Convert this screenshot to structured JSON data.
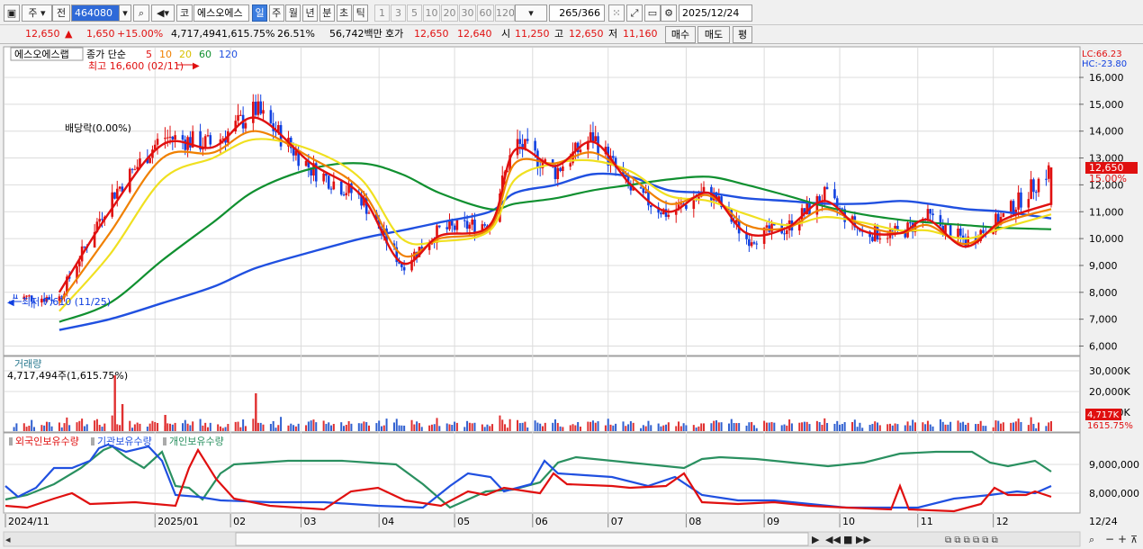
{
  "toolbar": {
    "period_label": "주",
    "prev_label": "전",
    "stock_code": "464080",
    "stock_name_short": "코",
    "stock_name": "에스오에스",
    "intervals": [
      "일",
      "주",
      "월",
      "년",
      "분",
      "초",
      "틱"
    ],
    "active_interval": "일",
    "counts": [
      "1",
      "3",
      "5",
      "10",
      "20",
      "30",
      "60",
      "120"
    ],
    "bar_count": "265",
    "bar_total": "/366",
    "date": "2025/12/24"
  },
  "info": {
    "price": "12,650",
    "change": "1,650",
    "change_pct": "+15.00%",
    "volume": "4,717,494",
    "volume_pct": "1,615.75%",
    "turnover_rate": "26.51%",
    "amount": "56,742백만",
    "quote_label": "호가",
    "ask": "12,650",
    "bid": "12,640",
    "open_label": "시",
    "open": "11,250",
    "high_label": "고",
    "high": "12,650",
    "low_label": "저",
    "low": "11,160",
    "buy_label": "매수",
    "sell_label": "매도",
    "eval_label": "평"
  },
  "price_pane": {
    "name_tag": "에스오에스랩",
    "legend_prefix": "종가 단순",
    "ma_legend": [
      {
        "period": "5",
        "color": "#e01010"
      },
      {
        "period": "10",
        "color": "#f08000"
      },
      {
        "period": "20",
        "color": "#f0e020"
      },
      {
        "period": "60",
        "color": "#109030"
      },
      {
        "period": "120",
        "color": "#2050e0"
      }
    ],
    "high_annotation": "최고 16,600 (02/11)",
    "low_annotation": "최저 7,610 (11/25)",
    "dividend_annotation": "배당락(0.00%)",
    "lc_label": "LC:66.23",
    "hc_label": "HC:-23.80",
    "y_ticks": [
      "16,000",
      "15,000",
      "14,000",
      "13,000",
      "12,000",
      "11,000",
      "10,000",
      "9,000",
      "8,000",
      "7,000",
      "6,000"
    ],
    "last_price_tag": "12,650",
    "last_change_tag": "15.00%"
  },
  "volume_pane": {
    "title": "거래량",
    "subtitle": "4,717,494주(1,615.75%)",
    "y_ticks": [
      "30,000K",
      "20,000K",
      "10,000K"
    ],
    "last_tag": "4,717K",
    "last_pct_tag": "1615.75%"
  },
  "holding_pane": {
    "legend": [
      {
        "name": "외국인보유수량",
        "color": "#e01010"
      },
      {
        "name": "기관보유수량",
        "color": "#2050e0"
      },
      {
        "name": "개인보유수량",
        "color": "#2a9060"
      }
    ],
    "y_ticks": [
      "9,000,000",
      "8,000,000"
    ]
  },
  "x_axis": {
    "labels": [
      "2024/11",
      "2025/01",
      "02",
      "03",
      "04",
      "05",
      "06",
      "07",
      "08",
      "09",
      "10",
      "11",
      "12"
    ],
    "right_label": "12/24"
  },
  "colors": {
    "up": "#e01010",
    "down": "#1040e0",
    "ma5": "#e01010",
    "ma10": "#f08000",
    "ma20": "#f0e020",
    "ma60": "#109030",
    "ma120": "#2050e0"
  },
  "chart_data": {
    "type": "line",
    "title": "에스오에스랩",
    "x": [
      "2024-11-25",
      "2024-12-15",
      "2025-01-05",
      "2025-01-25",
      "2025-02-11",
      "2025-03-05",
      "2025-03-25",
      "2025-04-10",
      "2025-04-25",
      "2025-05-15",
      "2025-05-25",
      "2025-06-10",
      "2025-06-25",
      "2025-07-10",
      "2025-07-25",
      "2025-08-10",
      "2025-08-25",
      "2025-09-10",
      "2025-09-25",
      "2025-10-10",
      "2025-10-25",
      "2025-11-05",
      "2025-11-20",
      "2025-12-05",
      "2025-12-24"
    ],
    "series": [
      {
        "name": "Close",
        "values": [
          7800,
          11500,
          13800,
          13500,
          14800,
          12600,
          11500,
          9000,
          10300,
          10600,
          13600,
          12500,
          13800,
          11800,
          10900,
          11800,
          10000,
          10400,
          11600,
          10200,
          10200,
          10800,
          9900,
          10800,
          12650
        ]
      },
      {
        "name": "5",
        "values": [
          8000,
          11000,
          13500,
          13400,
          14500,
          12800,
          11600,
          9100,
          10100,
          10500,
          13300,
          12700,
          13600,
          12000,
          11000,
          11700,
          10200,
          10400,
          11400,
          10300,
          10200,
          10700,
          9700,
          10700,
          11300
        ]
      },
      {
        "name": "10",
        "values": [
          7600,
          10200,
          13000,
          13200,
          14000,
          13000,
          11800,
          9400,
          10000,
          10400,
          12800,
          12800,
          13200,
          12300,
          11300,
          11600,
          10500,
          10400,
          11100,
          10500,
          10200,
          10500,
          9800,
          10600,
          11100
        ]
      },
      {
        "name": "20",
        "values": [
          7300,
          9400,
          12200,
          13000,
          13700,
          13300,
          12200,
          10000,
          9900,
          10300,
          12200,
          12800,
          12900,
          12500,
          11600,
          11400,
          10900,
          10500,
          10800,
          10600,
          10300,
          10300,
          10000,
          10400,
          10900
        ]
      },
      {
        "name": "60",
        "values": [
          6900,
          7600,
          9200,
          10600,
          11800,
          12600,
          12800,
          12400,
          11700,
          11100,
          11300,
          11500,
          11800,
          12000,
          12200,
          12300,
          12000,
          11600,
          11200,
          10900,
          10700,
          10600,
          10500,
          10400,
          10350
        ]
      },
      {
        "name": "120",
        "values": [
          6600,
          7000,
          7600,
          8200,
          8900,
          9500,
          10000,
          10300,
          10600,
          11000,
          11700,
          12000,
          12400,
          12300,
          11800,
          11700,
          11500,
          11400,
          11300,
          11300,
          11400,
          11300,
          11100,
          11000,
          10750
        ]
      }
    ],
    "ylim": [
      6000,
      16600
    ],
    "events": {
      "high": {
        "date": "2025-02-11",
        "value": 16600
      },
      "low": {
        "date": "2024-11-25",
        "value": 7610
      }
    }
  }
}
